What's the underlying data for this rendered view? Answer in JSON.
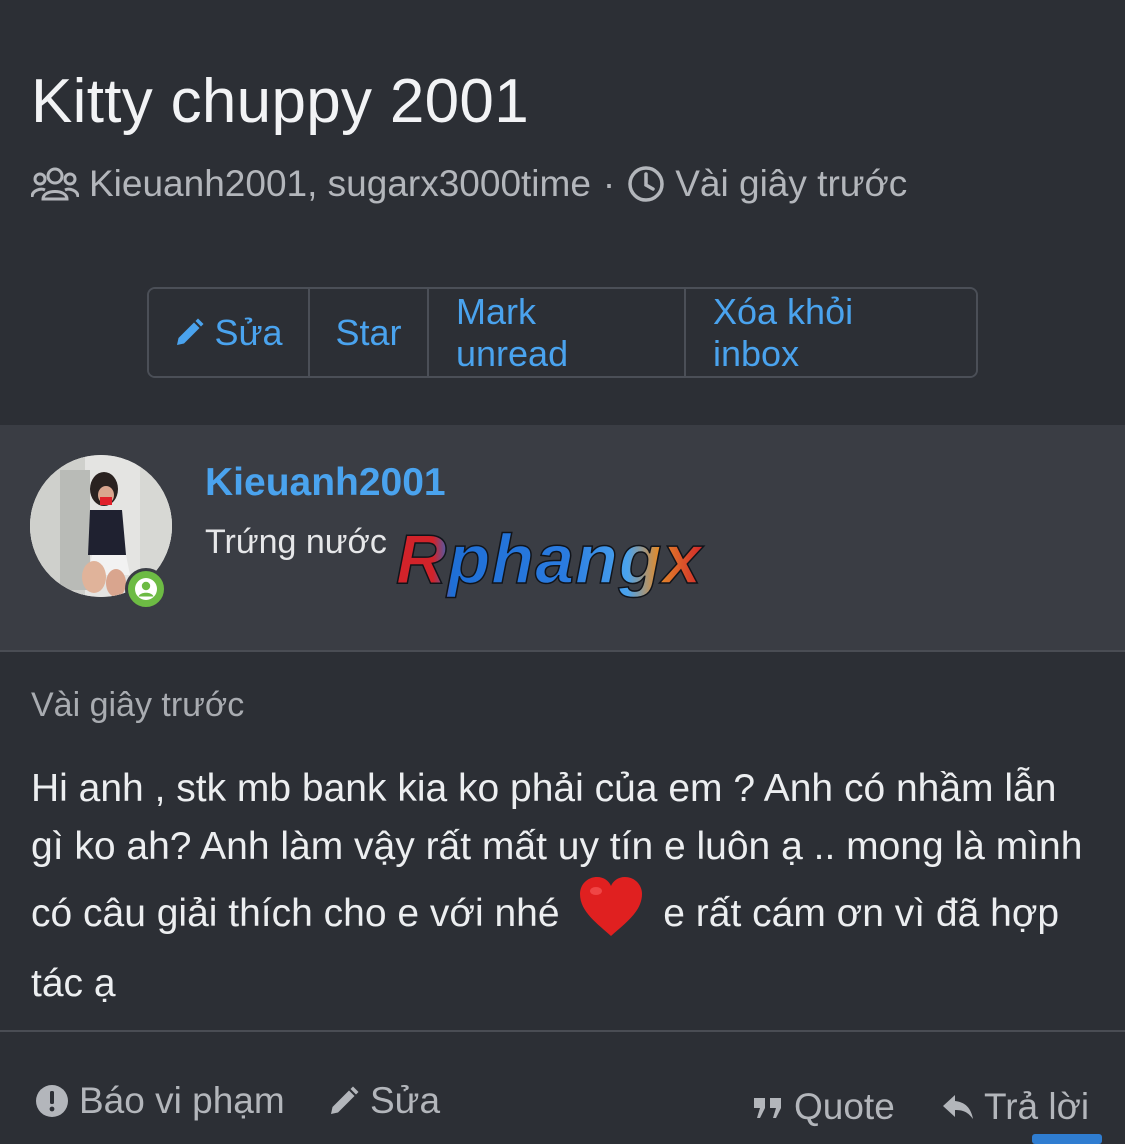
{
  "conversation": {
    "title": "Kitty chuppy 2001",
    "participants": "Kieuanh2001, sugarx3000time",
    "separator": "·",
    "time": "Vài giây trước"
  },
  "toolbar": {
    "edit_label": "Sửa",
    "star_label": "Star",
    "mark_unread_label": "Mark unread",
    "remove_label": "Xóa khỏi inbox"
  },
  "user": {
    "name": "Kieuanh2001",
    "rank": "Trứng nước",
    "banner_text": "Rphangx"
  },
  "message": {
    "time": "Vài giây trước",
    "text_part1": "Hi anh , stk mb bank kia ko phải của em ? Anh có nhầm lẫn gì ko ah? Anh làm vậy rất mất uy tín e luôn ạ .. mong là mình có câu giải thích cho e với nhé",
    "text_part2": "e rất cám ơn vì đã hợp tác ạ"
  },
  "actions": {
    "report_label": "Báo vi phạm",
    "edit_label": "Sửa",
    "quote_label": "Quote",
    "reply_label": "Trả lời"
  },
  "colors": {
    "accent": "#4aa3ee",
    "background": "#2c2f35",
    "panel": "#3a3d44",
    "online": "#6dbb44",
    "heart": "#e02020"
  }
}
